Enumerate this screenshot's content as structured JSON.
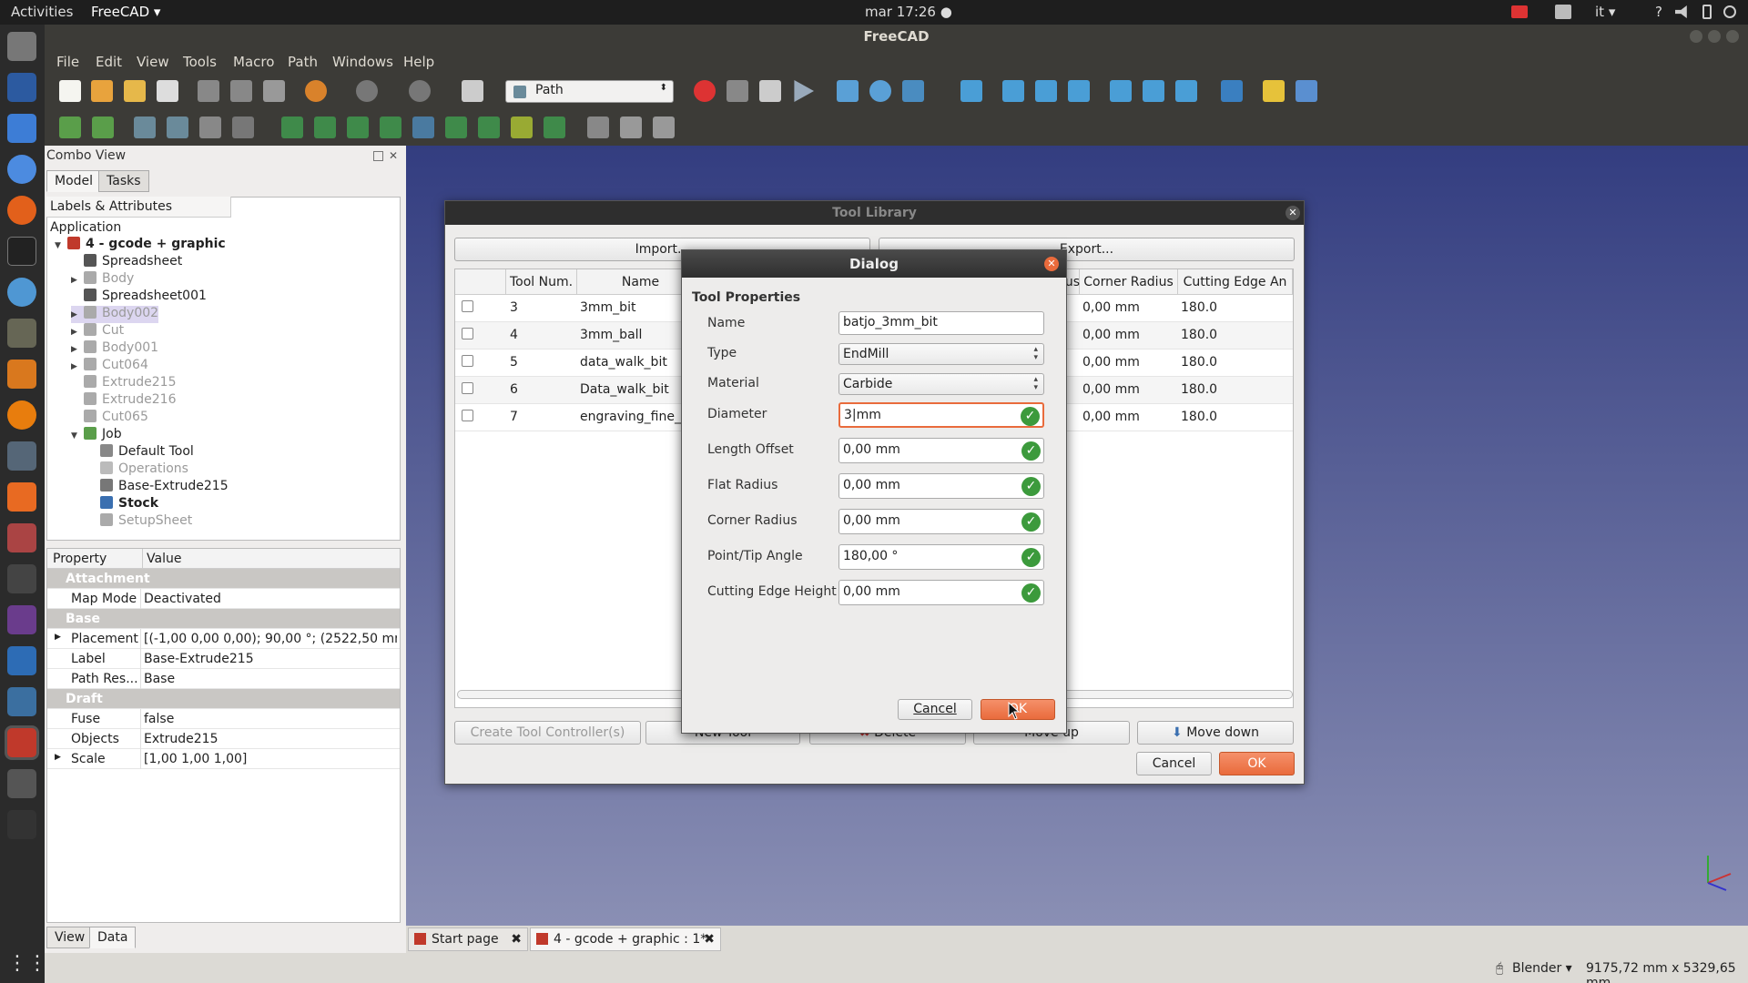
{
  "topbar": {
    "activities": "Activities",
    "app": "FreeCAD ▾",
    "clock": "mar 17:26 ●",
    "lang": "it ▾",
    "help": "?"
  },
  "window": {
    "title": "FreeCAD"
  },
  "menu": {
    "items": [
      "File",
      "Edit",
      "View",
      "Tools",
      "Macro",
      "Path",
      "Windows",
      "Help"
    ]
  },
  "workbench": {
    "selected": "Path"
  },
  "combo": {
    "title": "Combo View",
    "tab_model": "Model",
    "tab_tasks": "Tasks",
    "tree_header": "Labels & Attributes",
    "root": "Application",
    "tab_view": "View",
    "tab_data": "Data"
  },
  "tree": [
    {
      "label": "4 - gcode + graphic",
      "style": "bold"
    },
    {
      "label": "Spreadsheet",
      "style": "normal"
    },
    {
      "label": "Body",
      "style": "gray"
    },
    {
      "label": "Spreadsheet001",
      "style": "normal"
    },
    {
      "label": "Body002",
      "style": "gray"
    },
    {
      "label": "Cut",
      "style": "gray"
    },
    {
      "label": "Body001",
      "style": "gray"
    },
    {
      "label": "Cut064",
      "style": "gray"
    },
    {
      "label": "Extrude215",
      "style": "gray"
    },
    {
      "label": "Extrude216",
      "style": "gray"
    },
    {
      "label": "Cut065",
      "style": "gray"
    },
    {
      "label": "Job",
      "style": "normal"
    },
    {
      "label": "Default Tool",
      "style": "normal"
    },
    {
      "label": "Operations",
      "style": "gray"
    },
    {
      "label": "Base-Extrude215",
      "style": "normal"
    },
    {
      "label": "Stock",
      "style": "bold"
    },
    {
      "label": "SetupSheet",
      "style": "gray"
    }
  ],
  "props": {
    "hdr_property": "Property",
    "hdr_value": "Value",
    "rows": [
      {
        "name": "Attachment",
        "value": "",
        "group": true
      },
      {
        "name": "Map Mode",
        "value": "Deactivated",
        "group": false
      },
      {
        "name": "Base",
        "value": "",
        "group": true
      },
      {
        "name": "Placement",
        "value": "[(-1,00 0,00 0,00); 90,00 °; (2522,50 mm ...",
        "group": false
      },
      {
        "name": "Label",
        "value": "Base-Extrude215",
        "group": false
      },
      {
        "name": "Path Res...",
        "value": "Base",
        "group": false
      },
      {
        "name": "Draft",
        "value": "",
        "group": true
      },
      {
        "name": "Fuse",
        "value": "false",
        "group": false
      },
      {
        "name": "Objects",
        "value": "Extrude215",
        "group": false
      },
      {
        "name": "Scale",
        "value": "[1,00 1,00 1,00]",
        "group": false
      }
    ]
  },
  "toollib": {
    "title": "Tool Library",
    "import": "Import...",
    "export": "Export...",
    "columns": [
      "Tool Num.",
      "Name",
      "ius",
      "Corner Radius",
      "Cutting Edge An"
    ],
    "rows": [
      {
        "num": "3",
        "name": "3mm_bit",
        "corner": "0,00 mm",
        "edge": "180.0"
      },
      {
        "num": "4",
        "name": "3mm_ball",
        "corner": "0,00 mm",
        "edge": "180.0"
      },
      {
        "num": "5",
        "name": "data_walk_bit",
        "corner": "0,00 mm",
        "edge": "180.0"
      },
      {
        "num": "6",
        "name": "Data_walk_bit",
        "corner": "0,00 mm",
        "edge": "180.0"
      },
      {
        "num": "7",
        "name": "engraving_fine_t",
        "corner": "0,00 mm",
        "edge": "180.0"
      }
    ],
    "create_tc": "Create Tool Controller(s)",
    "new_tool": "New Tool",
    "delete": "Delete",
    "move_up": "Move up",
    "move_down": "Move down",
    "cancel": "Cancel",
    "ok": "OK"
  },
  "dialog": {
    "title": "Dialog",
    "section": "Tool Properties",
    "name_label": "Name",
    "name_value": "batjo_3mm_bit",
    "type_label": "Type",
    "type_value": "EndMill",
    "material_label": "Material",
    "material_value": "Carbide",
    "diameter_label": "Diameter",
    "diameter_value": "3|mm",
    "length_label": "Length Offset",
    "length_value": "0,00 mm",
    "flat_label": "Flat Radius",
    "flat_value": "0,00 mm",
    "corner_label": "Corner Radius",
    "corner_value": "0,00 mm",
    "tip_label": "Point/Tip Angle",
    "tip_value": "180,00 °",
    "edge_label": "Cutting Edge Height",
    "edge_value": "0,00 mm",
    "cancel": "Cancel",
    "ok": "OK"
  },
  "doctabs": {
    "start": "Start page",
    "doc": "4 - gcode + graphic : 1*"
  },
  "status": {
    "nav": "Blender ▾",
    "dims": "9175,72 mm x 5329,65 mm"
  },
  "colors": {
    "accent": "#e96b3c",
    "check": "#3c9a3c",
    "topbar": "#1e1e1e"
  }
}
